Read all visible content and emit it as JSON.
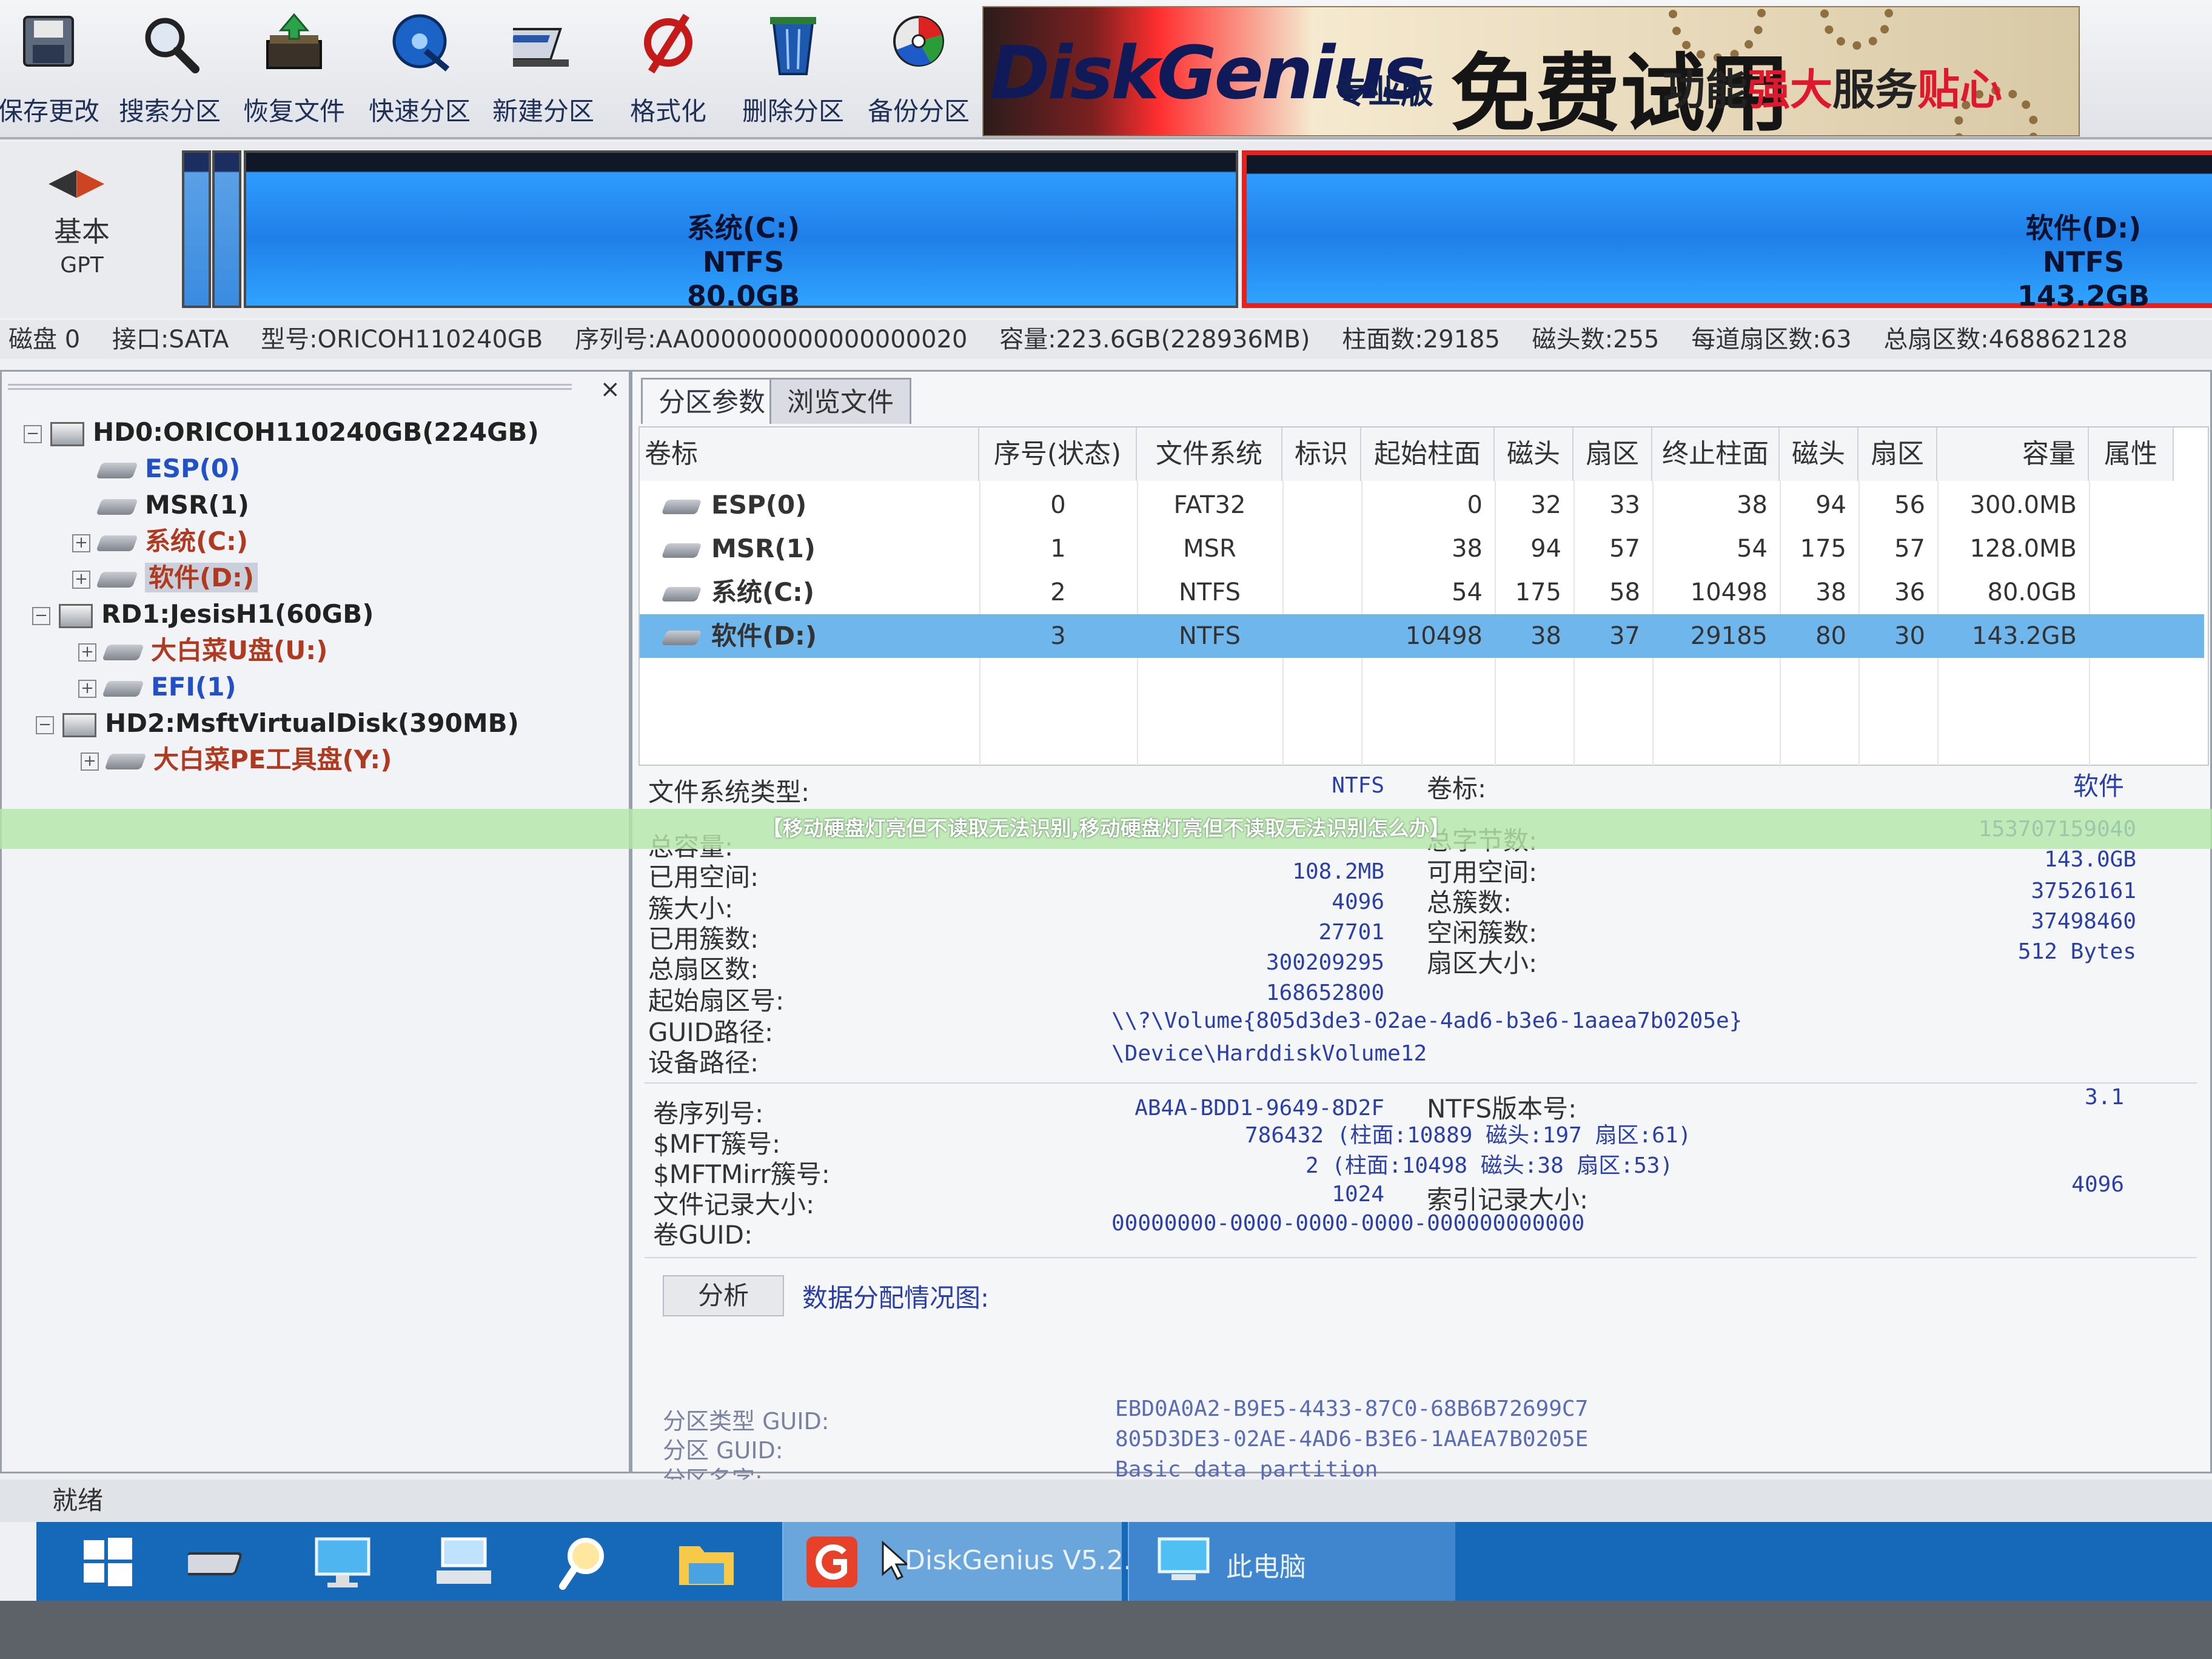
{
  "toolbar": {
    "buttons": [
      {
        "label": "保存更改",
        "icon": "disk-save-icon"
      },
      {
        "label": "搜索分区",
        "icon": "magnifier-icon"
      },
      {
        "label": "恢复文件",
        "icon": "restore-files-icon"
      },
      {
        "label": "快速分区",
        "icon": "quick-partition-icon"
      },
      {
        "label": "新建分区",
        "icon": "new-partition-icon"
      },
      {
        "label": "格式化",
        "icon": "format-icon"
      },
      {
        "label": "删除分区",
        "icon": "trash-icon"
      },
      {
        "label": "备份分区",
        "icon": "backup-icon"
      }
    ],
    "banner": {
      "logo": "DiskGenius",
      "edition": "专业版",
      "free": "免费试用",
      "tag_a": "功能",
      "tag_b": "强大",
      "tag_c": "服务",
      "tag_d": "贴心"
    }
  },
  "diskbar": {
    "disk_kind": "基本",
    "disk_scheme": "GPT",
    "partitions": [
      {
        "name": "系统(C:)",
        "fs": "NTFS",
        "size": "80.0GB"
      },
      {
        "name": "软件(D:)",
        "fs": "NTFS",
        "size": "143.2GB"
      }
    ]
  },
  "disk_info": {
    "disk": "磁盘 0",
    "iface": "接口:SATA",
    "model": "型号:ORICOH110240GB",
    "serial": "序列号:AA000000000000000020",
    "capacity": "容量:223.6GB(228936MB)",
    "cylinders": "柱面数:29185",
    "heads": "磁头数:255",
    "sectors_per_track": "每道扇区数:63",
    "total_sectors": "总扇区数:468862128"
  },
  "tree": {
    "close": "×",
    "nodes": [
      {
        "label": "HD0:ORICOH110240GB(224GB)",
        "pm": "−"
      },
      {
        "label": "ESP(0)"
      },
      {
        "label": "MSR(1)"
      },
      {
        "label": "系统(C:)",
        "pm": "+"
      },
      {
        "label": "软件(D:)",
        "pm": "+"
      },
      {
        "label": "RD1:JesisH1(60GB)",
        "pm": "−"
      },
      {
        "label": "大白菜U盘(U:)",
        "pm": "+"
      },
      {
        "label": "EFI(1)",
        "pm": "+"
      },
      {
        "label": "HD2:MsftVirtualDisk(390MB)",
        "pm": "−"
      },
      {
        "label": "大白菜PE工具盘(Y:)",
        "pm": "+"
      }
    ]
  },
  "tabs": {
    "params": "分区参数",
    "browse": "浏览文件"
  },
  "table": {
    "headers": [
      "卷标",
      "序号(状态)",
      "文件系统",
      "标识",
      "起始柱面",
      "磁头",
      "扇区",
      "终止柱面",
      "磁头",
      "扇区",
      "容量",
      "属性"
    ],
    "rows": [
      [
        "ESP(0)",
        "0",
        "FAT32",
        "",
        "0",
        "32",
        "33",
        "38",
        "94",
        "56",
        "300.0MB",
        ""
      ],
      [
        "MSR(1)",
        "1",
        "MSR",
        "",
        "38",
        "94",
        "57",
        "54",
        "175",
        "57",
        "128.0MB",
        ""
      ],
      [
        "系统(C:)",
        "2",
        "NTFS",
        "",
        "54",
        "175",
        "58",
        "10498",
        "38",
        "36",
        "80.0GB",
        ""
      ],
      [
        "软件(D:)",
        "3",
        "NTFS",
        "",
        "10498",
        "38",
        "37",
        "29185",
        "80",
        "30",
        "143.2GB",
        ""
      ]
    ]
  },
  "details": {
    "fs_type_label": "文件系统类型:",
    "fs_type": "NTFS",
    "vol_label_label": "卷标:",
    "vol_label": "软件",
    "total_cap_label": "总容量:",
    "total_bytes_label": "总字节数:",
    "total_bytes": "153707159040",
    "used_label": "已用空间:",
    "used": "108.2MB",
    "free_label": "可用空间:",
    "free": "143.0GB",
    "cluster_size_label": "簇大小:",
    "cluster_size": "4096",
    "total_clusters_label": "总簇数:",
    "total_clusters": "37526161",
    "used_clusters_label": "已用簇数:",
    "used_clusters": "27701",
    "free_clusters_label": "空闲簇数:",
    "free_clusters": "37498460",
    "total_sectors_label": "总扇区数:",
    "total_sectors": "300209295",
    "sector_size_label": "扇区大小:",
    "sector_size": "512 Bytes",
    "start_sector_label": "起始扇区号:",
    "start_sector": "168652800",
    "guid_path_label": "GUID路径:",
    "guid_path": "\\\\?\\Volume{805d3de3-02ae-4ad6-b3e6-1aaea7b0205e}",
    "device_path_label": "设备路径:",
    "device_path": "\\Device\\HarddiskVolume12",
    "serial_label": "卷序列号:",
    "serial": "AB4A-BDD1-9649-8D2F",
    "ntfs_ver_label": "NTFS版本号:",
    "ntfs_ver": "3.1",
    "mft_label": "$MFT簇号:",
    "mft": "786432 (柱面:10889 磁头:197 扇区:61)",
    "mftmirr_label": "$MFTMirr簇号:",
    "mftmirr": "2 (柱面:10498 磁头:38 扇区:53)",
    "record_size_label": "文件记录大小:",
    "record_size": "1024",
    "index_size_label": "索引记录大小:",
    "index_size": "4096",
    "vol_guid_label": "卷GUID:",
    "vol_guid": "00000000-0000-0000-0000-000000000000",
    "analyze_button": "分析",
    "alloc_label": "数据分配情况图:",
    "ptype_guid_label": "分区类型 GUID:",
    "ptype_guid": "EBD0A0A2-B9E5-4433-87C0-68B6B72699C7",
    "pguid_label": "分区 GUID:",
    "pguid": "805D3DE3-02AE-4AD6-B3E6-1AAEA7B0205E",
    "pname_label": "分区名字:",
    "pname": "Basic data partition"
  },
  "caption": "【移动硬盘灯亮但不读取无法识别,移动硬盘灯亮但不读取无法识别怎么办】",
  "status": "就绪",
  "taskbar": {
    "app_task": "DiskGenius V5.2...",
    "pc_task": "此电脑"
  },
  "colors": {
    "accent_blue": "#1f7fe8",
    "selected_row": "#6fb6ec",
    "partition_d_border": "#e3221f",
    "taskbar": "#1668b8"
  }
}
